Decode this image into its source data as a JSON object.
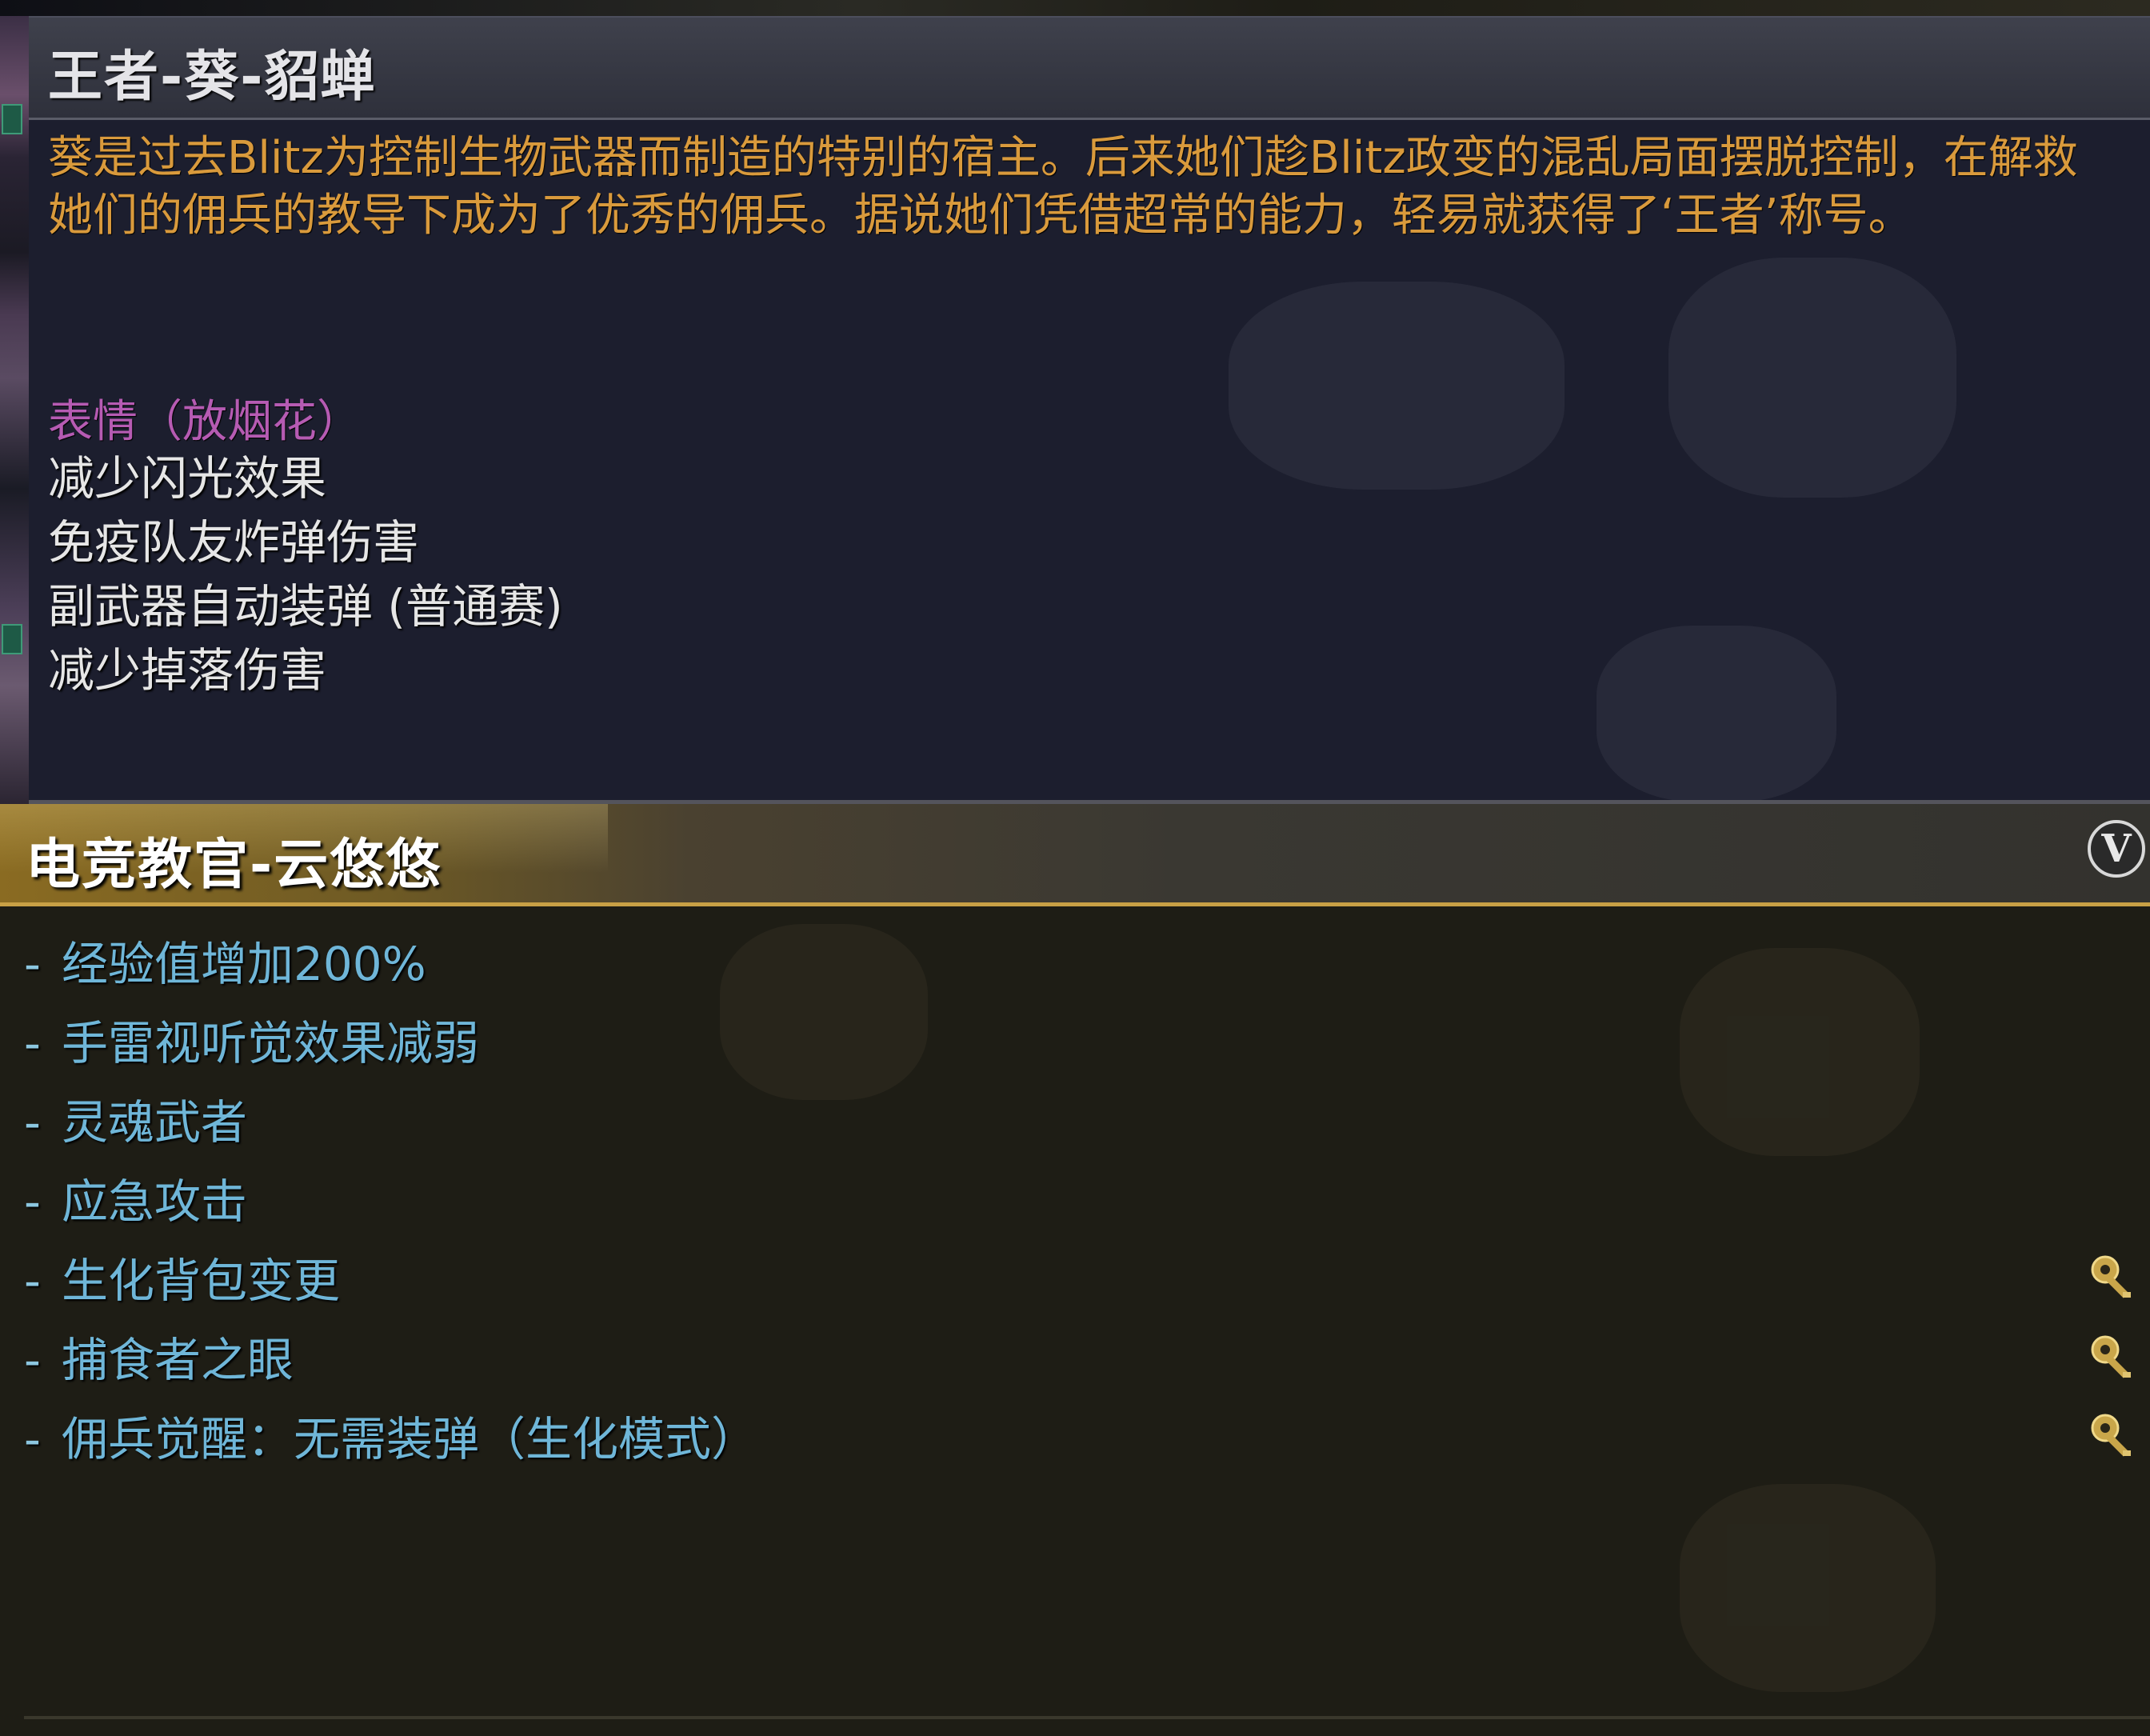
{
  "tooltip_top": {
    "title": "王者-葵-貂蝉",
    "description": "葵是过去Blitz为控制生物武器而制造的特别的宿主。后来她们趁Blitz政变的混乱局面摆脱控制，在解救她们的佣兵的教导下成为了优秀的佣兵。据说她们凭借超常的能力，轻易就获得了‘王者’称号。",
    "emote": "表情（放烟花）",
    "features": [
      "减少闪光效果",
      "免疫队友炸弹伤害",
      "副武器自动装弹 (普通赛)",
      "减少掉落伤害"
    ]
  },
  "tooltip_bottom": {
    "title": "电竞教官-云悠悠",
    "badge": "V",
    "skills": [
      {
        "dash": "-",
        "label": "经验值增加200%",
        "key_icon": false
      },
      {
        "dash": "-",
        "label": "手雷视听觉效果减弱",
        "key_icon": false
      },
      {
        "dash": "-",
        "label": "灵魂武者",
        "key_icon": false
      },
      {
        "dash": "-",
        "label": "应急攻击",
        "key_icon": false
      },
      {
        "dash": "-",
        "label": "生化背包变更",
        "key_icon": true
      },
      {
        "dash": "-",
        "label": "捕食者之眼",
        "key_icon": true
      },
      {
        "dash": "-",
        "label": "佣兵觉醒：无需装弹（生化模式）",
        "key_icon": true
      }
    ]
  },
  "colors": {
    "description": "#d99a3c",
    "emote": "#b65bb3",
    "feature": "#e6e6e6",
    "skill": "#6fb6d8",
    "gold_accent": "#c8a045"
  },
  "icons": {
    "badge": "v-badge-icon",
    "skill_marker": "gold-key-icon"
  }
}
